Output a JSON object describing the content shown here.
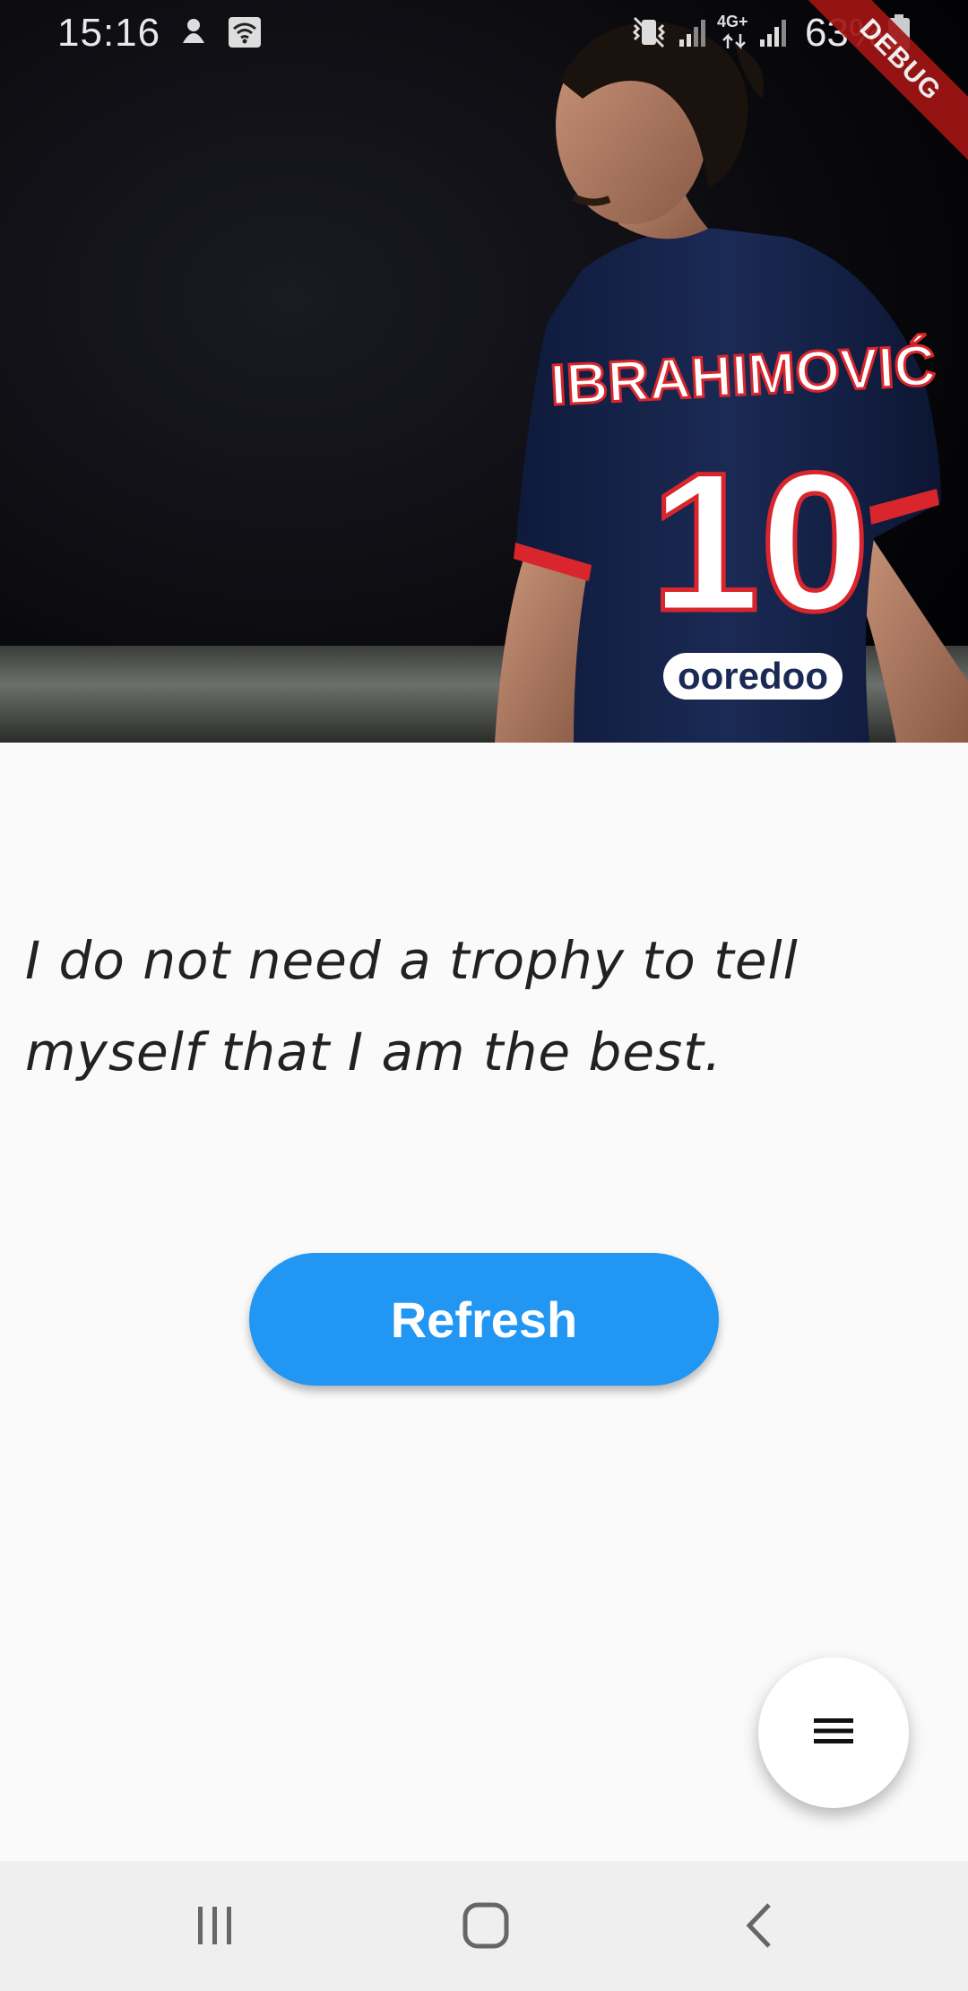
{
  "status_bar": {
    "time": "15:16",
    "battery_percent": "63%",
    "network_label": "4G+",
    "icons": [
      "notification-icon",
      "wifi-box-icon",
      "vibrate-icon",
      "signal-icon",
      "signal-icon",
      "battery-icon"
    ]
  },
  "debug_banner": "DEBUG",
  "hero": {
    "jersey_name": "IBRAHIMOVIĆ",
    "jersey_number": "10",
    "sponsor": "ooredoo"
  },
  "quote": {
    "text": "I do not need a trophy to tell myself that I am the best."
  },
  "refresh_button": {
    "label": "Refresh",
    "color": "#2196f3"
  },
  "fab": {
    "icon": "menu-icon"
  },
  "nav_bar": {
    "icons": [
      "recents-icon",
      "home-icon",
      "back-icon"
    ]
  }
}
